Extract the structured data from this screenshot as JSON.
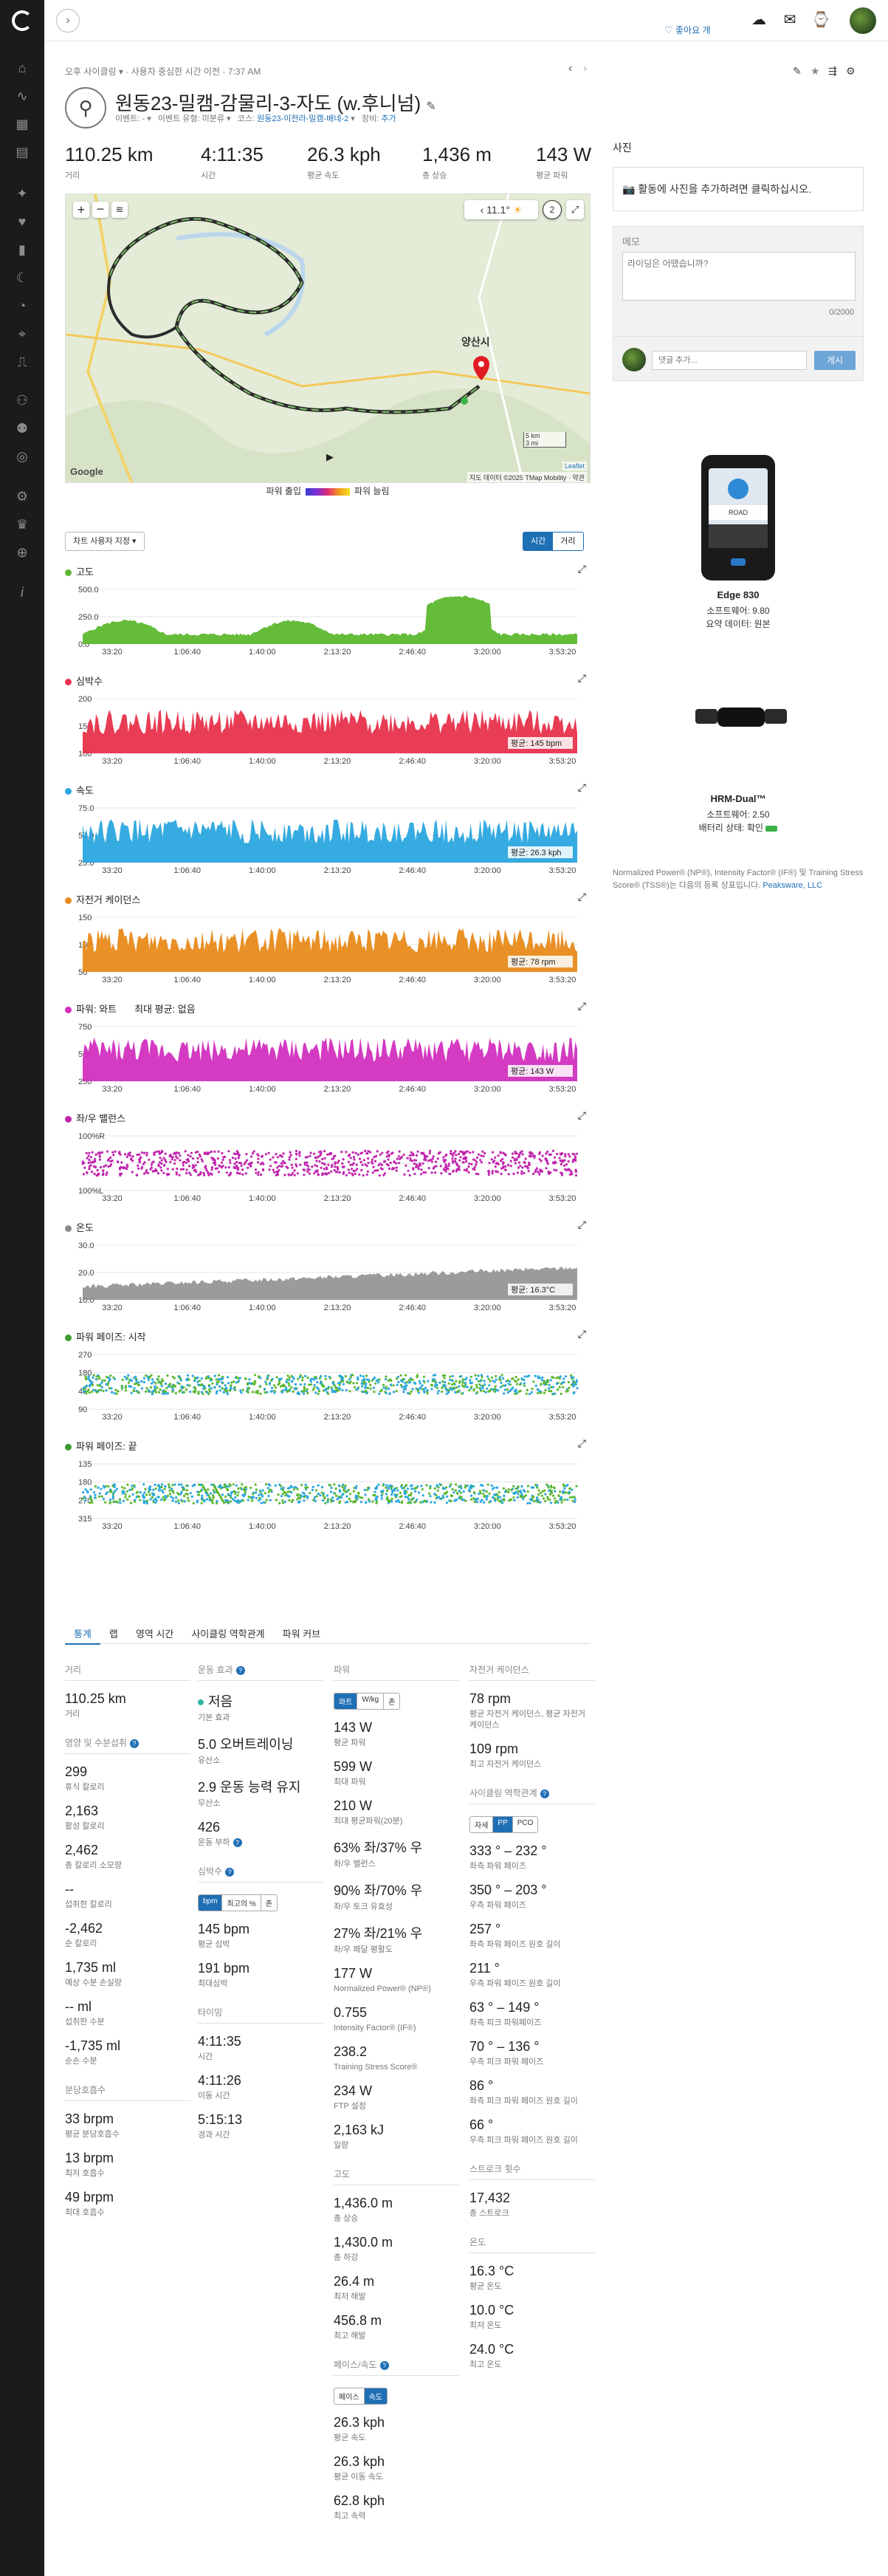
{
  "breadcrumb": {
    "pre": "오후 사이클링",
    "sep": "사용자 중심한 시간 이전",
    "time": "7:37 AM"
  },
  "header": {
    "title": "원동23-밀캠-감물리-3-자도 (w.후니넘)",
    "event_label": "이벤트: -",
    "event_type_label": "이벤트 유형: 미분류",
    "course_label": "코스:",
    "course_value": "원동23-이전라-밀캠-배네-2",
    "gear_label": "장비:",
    "gear_value": "추가",
    "like_label": "좋아요 개"
  },
  "kpis": [
    {
      "value": "110.25 km",
      "label": "거리"
    },
    {
      "value": "4:11:35",
      "label": "시간"
    },
    {
      "value": "26.3 kph",
      "label": "평균 속도"
    },
    {
      "value": "1,436 m",
      "label": "총 상승"
    },
    {
      "value": "143 W",
      "label": "평균 파워"
    }
  ],
  "map": {
    "temp": "11.1°",
    "wind": "2",
    "city": "양산시",
    "scale_km": "5 km",
    "scale_mi": "3 mi",
    "attribution": "지도 데이터 ©2025 TMap Mobility · 약관",
    "leaflet": "Leaflet",
    "google": "Google",
    "route_color": "#2b2b2b"
  },
  "power_legend": {
    "low": "파워 출입",
    "high": "파워 늘림"
  },
  "controls": {
    "select_label": "차트 사용자 지정",
    "toggle_time": "시간",
    "toggle_distance": "거리"
  },
  "charts": [
    {
      "title": "고도",
      "color": "#5cb82e",
      "yticks": [
        "500.0",
        "250.0",
        "0.0"
      ],
      "avg": ""
    },
    {
      "title": "심박수",
      "color": "#e8324c",
      "yticks": [
        "200",
        "150",
        "100"
      ],
      "avg": "평균: 145 bpm"
    },
    {
      "title": "속도",
      "color": "#2aa7df",
      "yticks": [
        "75.0",
        "50.0",
        "25.0"
      ],
      "avg": "평균: 26.3 kph"
    },
    {
      "title": "자전거 케이던스",
      "color": "#e88a1a",
      "yticks": [
        "150",
        "100",
        "50"
      ],
      "avg": "평균: 78 rpm"
    },
    {
      "title": "파워: 와트",
      "color": "#d22fbf",
      "yticks": [
        "750",
        "500",
        "250"
      ],
      "avg": "평균: 143 W",
      "extra": "최대 평균: 없음"
    },
    {
      "title": "좌/우 밸런스",
      "color": "#c125ad",
      "yticks": [
        "100%R",
        "",
        "100%L"
      ],
      "avg": ""
    },
    {
      "title": "온도",
      "color": "#8a8a8a",
      "yticks": [
        "30.0",
        "20.0",
        "10.0"
      ],
      "avg": "평균: 16.3°C"
    },
    {
      "title": "파워 페이즈: 시작",
      "color": "#3a9a2e",
      "yticks": [
        "270",
        "180",
        "45",
        "90"
      ],
      "avg": ""
    },
    {
      "title": "파워 페이즈: 끝",
      "color": "#3a9a2e",
      "yticks": [
        "135",
        "180",
        "270",
        "315"
      ],
      "avg": ""
    }
  ],
  "xticks": [
    "33:20",
    "1:06:40",
    "1:40:00",
    "2:13:20",
    "2:46:40",
    "3:20:00",
    "3:53:20"
  ],
  "stats_tabs": [
    "통계",
    "랩",
    "영역 시간",
    "사이클링 역학관계",
    "파워 커브"
  ],
  "col1": {
    "distance_head": "거리",
    "distance": "110.25 km",
    "distance_label": "거리",
    "nutrition_head": "영양 및 수분섭취",
    "rows": [
      {
        "v": "299",
        "l": "휴식 칼로리"
      },
      {
        "v": "2,163",
        "l": "활성 칼로리"
      },
      {
        "v": "2,462",
        "l": "총 칼로리 소모량"
      },
      {
        "v": "--",
        "l": "섭취한 칼로리"
      },
      {
        "v": "-2,462",
        "l": "순 칼로리"
      },
      {
        "v": "1,735 ml",
        "l": "예상 수분 손실량"
      },
      {
        "v": "-- ml",
        "l": "섭취한 수분"
      },
      {
        "v": "-1,735 ml",
        "l": "순손 수분"
      }
    ],
    "resp_head": "분당호흡수",
    "resp": [
      {
        "v": "33 brpm",
        "l": "평균 분당호흡수"
      },
      {
        "v": "13 brpm",
        "l": "최저 호흡수"
      },
      {
        "v": "49 brpm",
        "l": "최대 호흡수"
      }
    ]
  },
  "col2": {
    "te_head": "운동 효과",
    "te_main": "저음",
    "te_main_label": "기본 효과",
    "aerobic": "5.0 오버트레이닝",
    "aerobic_label": "유산소",
    "anaerobic": "2.9 운동 능력 유지",
    "anaerobic_label": "무산소",
    "load": "426",
    "load_label": "운동 부하",
    "hr_head": "심박수",
    "hr_toggle": [
      "bpm",
      "최고의 %",
      "존"
    ],
    "hr": [
      {
        "v": "145 bpm",
        "l": "평균 심박"
      },
      {
        "v": "191 bpm",
        "l": "최대심박"
      }
    ],
    "time_head": "타이밍",
    "time": [
      {
        "v": "4:11:35",
        "l": "시간"
      },
      {
        "v": "4:11:26",
        "l": "이동 시간"
      },
      {
        "v": "5:15:13",
        "l": "경과 시간"
      }
    ]
  },
  "col3": {
    "power_head": "파워",
    "power_toggle": [
      "와트",
      "W/kg",
      "존"
    ],
    "power": [
      {
        "v": "143 W",
        "l": "평균 파워"
      },
      {
        "v": "599 W",
        "l": "최대 파워"
      },
      {
        "v": "210 W",
        "l": "최대 평균파워(20분)"
      },
      {
        "v": "63% 좌/37% 우",
        "l": "좌/우 밸런스"
      },
      {
        "v": "90% 좌/70% 우",
        "l": "좌/우 토크 유효성"
      },
      {
        "v": "27% 좌/21% 우",
        "l": "좌/우 페달 평활도"
      },
      {
        "v": "177 W",
        "l": "Normalized Power® (NP®)"
      },
      {
        "v": "0.755",
        "l": "Intensity Factor® (IF®)"
      },
      {
        "v": "238.2",
        "l": "Training Stress Score®"
      },
      {
        "v": "234 W",
        "l": "FTP 설정"
      },
      {
        "v": "2,163 kJ",
        "l": "일량"
      }
    ],
    "elev_head": "고도",
    "elev": [
      {
        "v": "1,436.0 m",
        "l": "총 상승"
      },
      {
        "v": "1,430.0 m",
        "l": "총 하강"
      },
      {
        "v": "26.4 m",
        "l": "최저 해발"
      },
      {
        "v": "456.8 m",
        "l": "최고 해발"
      }
    ],
    "speed_head": "페이스/속도",
    "speed_toggle": [
      "페이스",
      "속도"
    ],
    "speed": [
      {
        "v": "26.3 kph",
        "l": "평균 속도"
      },
      {
        "v": "26.3 kph",
        "l": "평균 이동 속도"
      },
      {
        "v": "62.8 kph",
        "l": "최고 속력"
      }
    ]
  },
  "col4": {
    "cad_head": "자전거 케이던스",
    "cad": [
      {
        "v": "78 rpm",
        "l": "평균 자전거 케이던스, 평균 자전거 케이던스"
      },
      {
        "v": "109 rpm",
        "l": "최고 자전거 케이던스"
      }
    ],
    "dyn_head": "사이클링 역학관계",
    "dyn_toggle": [
      "자세",
      "PP",
      "PCO"
    ],
    "dyn": [
      {
        "v": "333 ° – 232 °",
        "l": "좌측 파워 페이즈"
      },
      {
        "v": "350 ° – 203 °",
        "l": "우측 파워 페이즈"
      },
      {
        "v": "257 °",
        "l": "좌측 파워 페이즈 원호 길이"
      },
      {
        "v": "211 °",
        "l": "우측 파워 페이즈 원호 길이"
      },
      {
        "v": "63 ° – 149 °",
        "l": "좌측 피크 파워페이즈"
      },
      {
        "v": "70 ° – 136 °",
        "l": "우측 피크 파워 페이즈"
      },
      {
        "v": "86 °",
        "l": "좌측 피크 파워 페이즈 원호 길이"
      },
      {
        "v": "66 °",
        "l": "우측 피크 파워 페이즈 원호 길이"
      }
    ],
    "stroke_head": "스트로크 횟수",
    "stroke": [
      {
        "v": "17,432",
        "l": "총 스트로크"
      }
    ],
    "temp_head": "온도",
    "temp": [
      {
        "v": "16.3 °C",
        "l": "평균 온도"
      },
      {
        "v": "10.0 °C",
        "l": "최저 온도"
      },
      {
        "v": "24.0 °C",
        "l": "최고 온도"
      }
    ]
  },
  "right": {
    "photo_head": "사진",
    "photo_add": "활동에 사진을 추가하려면 클릭하십시오.",
    "memo_head": "메모",
    "memo_placeholder": "라이딩은 어땠습니까?",
    "memo_count": "0/2000",
    "comment_placeholder": "댓글 추가...",
    "comment_button": "게시",
    "device1_name": "Edge 830",
    "device1_fw": "소프트웨어: 9.80",
    "device1_data": "요약 데이터: 원본",
    "device2_name": "HRM-Dual™",
    "device2_fw": "소프트웨어: 2.50",
    "device2_battery": "배터리 상태: 확인",
    "tm_text": "Normalized Power® (NP®), Intensity Factor® (IF®) 및 Training Stress Score® (TSS®)는 다음의 등록 상표입니다.",
    "tm_link": "Peaksware, LLC"
  }
}
